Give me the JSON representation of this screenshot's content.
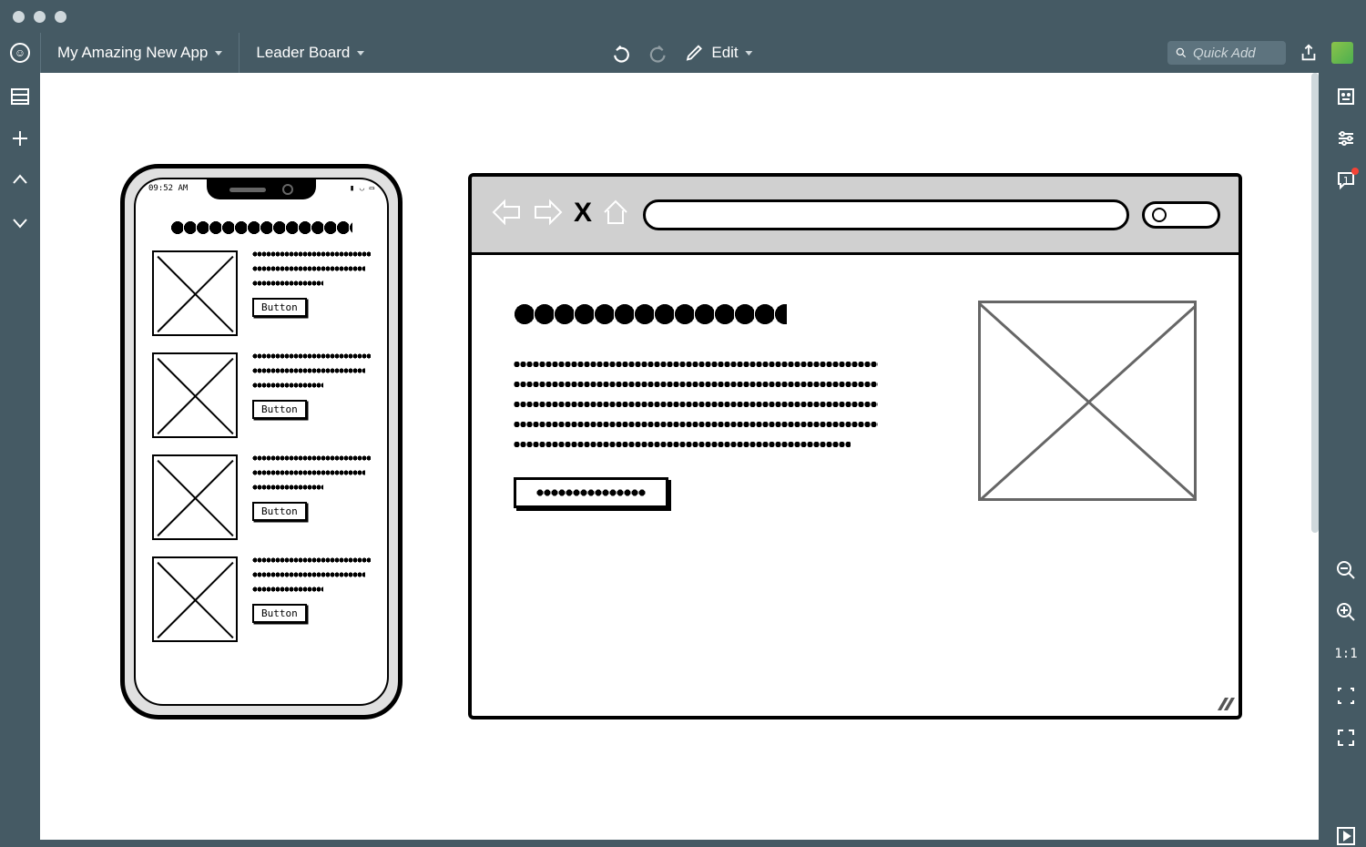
{
  "window": {
    "traffic_lights": 3
  },
  "topbar": {
    "project_name": "My Amazing New App",
    "page_name": "Leader Board",
    "edit_label": "Edit",
    "quick_add_placeholder": "Quick Add"
  },
  "left_sidebar": {
    "items": [
      "panel-toggle",
      "add",
      "chevron-up",
      "chevron-down"
    ]
  },
  "right_sidebar": {
    "comments_count": "1",
    "zoom_label": "1:1"
  },
  "canvas": {
    "phone": {
      "time": "09:52 AM",
      "button_label": "Button",
      "row_count": 4
    },
    "browser": {}
  }
}
